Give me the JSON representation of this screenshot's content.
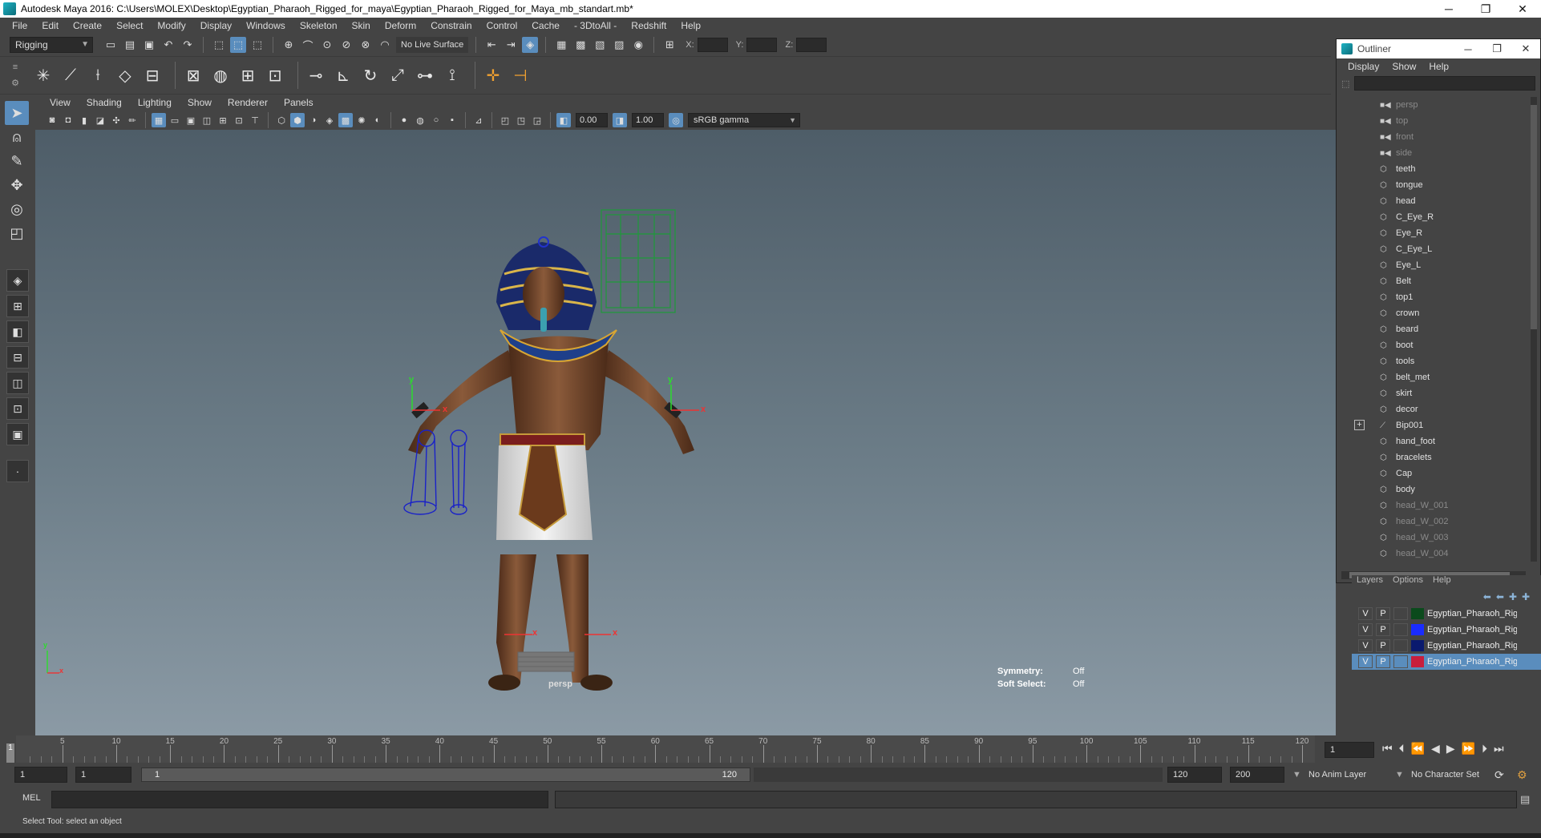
{
  "window": {
    "title": "Autodesk Maya 2016: C:\\Users\\MOLEX\\Desktop\\Egyptian_Pharaoh_Rigged_for_maya\\Egyptian_Pharaoh_Rigged_for_Maya_mb_standart.mb*",
    "minimize": "─",
    "maximize": "❐",
    "close": "✕"
  },
  "menubar": [
    "File",
    "Edit",
    "Create",
    "Select",
    "Modify",
    "Display",
    "Windows",
    "Skeleton",
    "Skin",
    "Deform",
    "Constrain",
    "Control",
    "Cache",
    "- 3DtoAll -",
    "Redshift",
    "Help"
  ],
  "statusline": {
    "mode": "Rigging",
    "live_surface": "No Live Surface",
    "x_label": "X:",
    "y_label": "Y:",
    "z_label": "Z:"
  },
  "panel": {
    "menu": [
      "View",
      "Shading",
      "Lighting",
      "Show",
      "Renderer",
      "Panels"
    ],
    "exposure": "0.00",
    "gamma": "1.00",
    "color_space": "sRGB gamma"
  },
  "viewport": {
    "camera": "persp",
    "symmetry_label": "Symmetry:",
    "symmetry_value": "Off",
    "soft_select_label": "Soft Select:",
    "soft_select_value": "Off",
    "axis_y": "y",
    "axis_x": "x"
  },
  "outliner": {
    "title": "Outliner",
    "menu": [
      "Display",
      "Show",
      "Help"
    ],
    "items": [
      {
        "label": "persp",
        "type": "camera",
        "dim": true
      },
      {
        "label": "top",
        "type": "camera",
        "dim": true
      },
      {
        "label": "front",
        "type": "camera",
        "dim": true
      },
      {
        "label": "side",
        "type": "camera",
        "dim": true
      },
      {
        "label": "teeth",
        "type": "mesh",
        "dim": false
      },
      {
        "label": "tongue",
        "type": "mesh",
        "dim": false
      },
      {
        "label": "head",
        "type": "mesh",
        "dim": false
      },
      {
        "label": "C_Eye_R",
        "type": "mesh",
        "dim": false
      },
      {
        "label": "Eye_R",
        "type": "mesh",
        "dim": false
      },
      {
        "label": "C_Eye_L",
        "type": "mesh",
        "dim": false
      },
      {
        "label": "Eye_L",
        "type": "mesh",
        "dim": false
      },
      {
        "label": "Belt",
        "type": "mesh",
        "dim": false
      },
      {
        "label": "top1",
        "type": "mesh",
        "dim": false
      },
      {
        "label": "crown",
        "type": "mesh",
        "dim": false
      },
      {
        "label": "beard",
        "type": "mesh",
        "dim": false
      },
      {
        "label": "boot",
        "type": "mesh",
        "dim": false
      },
      {
        "label": "tools",
        "type": "mesh",
        "dim": false
      },
      {
        "label": "belt_met",
        "type": "mesh",
        "dim": false
      },
      {
        "label": "skirt",
        "type": "mesh",
        "dim": false
      },
      {
        "label": "decor",
        "type": "mesh",
        "dim": false
      },
      {
        "label": "Bip001",
        "type": "joint",
        "dim": false,
        "expandable": true
      },
      {
        "label": "hand_foot",
        "type": "mesh",
        "dim": false
      },
      {
        "label": "bracelets",
        "type": "mesh",
        "dim": false
      },
      {
        "label": "Cap",
        "type": "mesh",
        "dim": false
      },
      {
        "label": "body",
        "type": "mesh",
        "dim": false
      },
      {
        "label": "head_W_001",
        "type": "mesh",
        "dim": true
      },
      {
        "label": "head_W_002",
        "type": "mesh",
        "dim": true
      },
      {
        "label": "head_W_003",
        "type": "mesh",
        "dim": true
      },
      {
        "label": "head_W_004",
        "type": "mesh",
        "dim": true
      }
    ]
  },
  "layers": {
    "menu": [
      "Layers",
      "Options",
      "Help"
    ],
    "items": [
      {
        "v": "V",
        "p": "P",
        "color": "#0b4a1c",
        "name": "Egyptian_Pharaoh_Rig",
        "selected": false
      },
      {
        "v": "V",
        "p": "P",
        "color": "#1a2cff",
        "name": "Egyptian_Pharaoh_Rig",
        "selected": false
      },
      {
        "v": "V",
        "p": "P",
        "color": "#0a1a6e",
        "name": "Egyptian_Pharaoh_Rig",
        "selected": false
      },
      {
        "v": "V",
        "p": "P",
        "color": "#c81e3c",
        "name": "Egyptian_Pharaoh_Rig",
        "selected": true
      }
    ]
  },
  "timeslider": {
    "ticks": [
      "5",
      "10",
      "15",
      "20",
      "25",
      "30",
      "35",
      "40",
      "45",
      "50",
      "55",
      "60",
      "65",
      "70",
      "75",
      "80",
      "85",
      "90",
      "95",
      "100",
      "105",
      "110",
      "115",
      "120"
    ],
    "current_frame": "1",
    "frame_field": "1"
  },
  "rangeslider": {
    "start_field": "1",
    "playback_start": "1",
    "range_start": "1",
    "range_end": "120",
    "playback_end": "120",
    "end_field": "200",
    "anim_layer": "No Anim Layer",
    "character_set": "No Character Set"
  },
  "cmdline": {
    "mode": "MEL"
  },
  "helpline": {
    "text": "Select Tool: select an object"
  }
}
